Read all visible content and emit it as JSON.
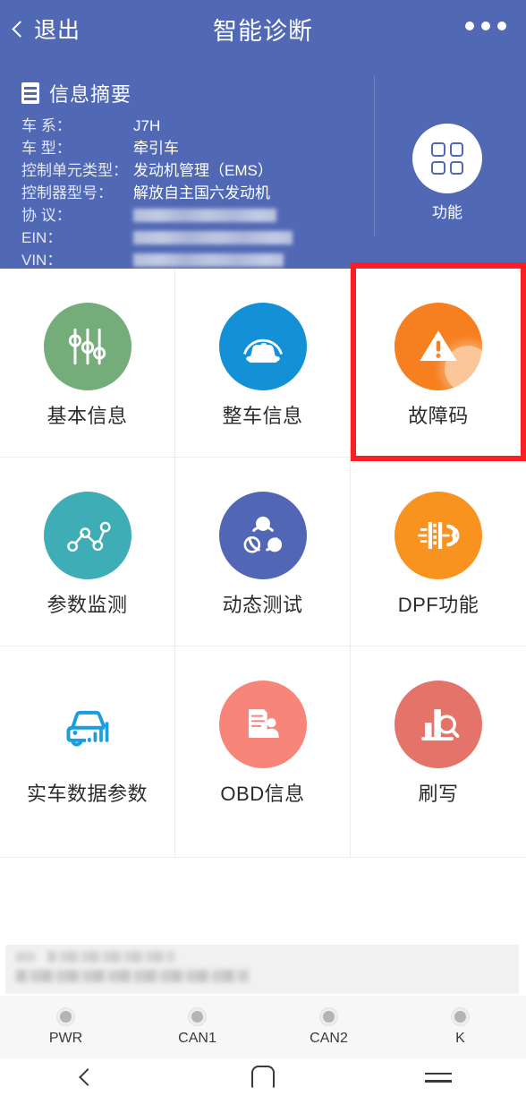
{
  "nav": {
    "back_label": "退出",
    "title": "智能诊断",
    "more_icon": "ellipsis-icon"
  },
  "summary": {
    "icon": "list-icon",
    "title": "信息摘要",
    "rows": [
      {
        "label": "车 系：",
        "value": "J7H",
        "redacted": false
      },
      {
        "label": "车 型：",
        "value": "牵引车",
        "redacted": false
      },
      {
        "label": "控制单元类型：",
        "value": "发动机管理（EMS）",
        "redacted": false
      },
      {
        "label": "控制器型号：",
        "value": "解放自主国六发动机",
        "redacted": false
      },
      {
        "label": "协 议：",
        "value": "",
        "redacted": true,
        "redact_width": 160
      },
      {
        "label": "EIN：",
        "value": "",
        "redacted": true,
        "redact_width": 178
      },
      {
        "label": "VIN：",
        "value": "",
        "redacted": true,
        "redact_width": 168
      }
    ]
  },
  "function_button": {
    "label": "功能",
    "icon": "grid-four-squares-icon"
  },
  "grid": {
    "items": [
      {
        "label": "基本信息",
        "icon": "sliders-icon",
        "color": "#74ad79",
        "plain": false
      },
      {
        "label": "整车信息",
        "icon": "car-arc-icon",
        "color": "#1390d6",
        "plain": false
      },
      {
        "label": "故障码",
        "icon": "warning-triangle-icon",
        "color": "#f68020",
        "plain": false,
        "highlighted": true
      },
      {
        "label": "参数监测",
        "icon": "line-chart-nodes-icon",
        "color": "#3eadb5",
        "plain": false
      },
      {
        "label": "动态测试",
        "icon": "share-nodes-icon",
        "color": "#5166b5",
        "plain": false
      },
      {
        "label": "DPF功能",
        "icon": "dpf-filter-icon",
        "color": "#f7931e",
        "plain": false
      },
      {
        "label": "实车数据参数",
        "icon": "car-outline-bars-icon",
        "color": "#1a9edd",
        "plain": true
      },
      {
        "label": "OBD信息",
        "icon": "document-person-icon",
        "color": "#f8857a",
        "plain": false
      },
      {
        "label": "刷写",
        "icon": "bars-magnifier-icon",
        "color": "#e4736a",
        "plain": false
      }
    ]
  },
  "highlight": {
    "color": "#fb1f24",
    "target": "故障码"
  },
  "status_leds": [
    {
      "label": "PWR",
      "state": "off"
    },
    {
      "label": "CAN1",
      "state": "off"
    },
    {
      "label": "CAN2",
      "state": "off"
    },
    {
      "label": "K",
      "state": "off"
    }
  ],
  "android_nav": {
    "back": "back-chevron-icon",
    "home": "home-squircle-icon",
    "recents": "menu-lines-icon"
  }
}
